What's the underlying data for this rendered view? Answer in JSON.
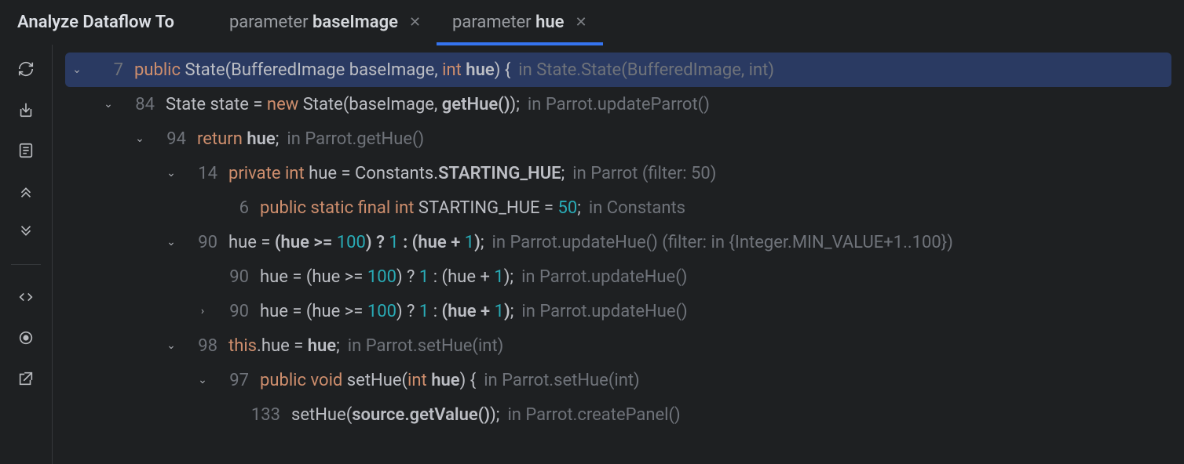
{
  "header": {
    "title": "Analyze Dataflow To",
    "tabs": [
      {
        "prefix": "parameter ",
        "name": "baseImage",
        "active": false
      },
      {
        "prefix": "parameter ",
        "name": "hue",
        "active": true
      }
    ]
  },
  "sidebar_icons": [
    "refresh-icon",
    "import-icon",
    "outline-icon",
    "collapse-up-icon",
    "collapse-down-icon",
    "divider",
    "code-icon",
    "target-icon",
    "open-external-icon"
  ],
  "rows": [
    {
      "indent": 0,
      "chev": "down",
      "line": 7,
      "sel": true,
      "tokens": [
        [
          "kw",
          "public"
        ],
        [
          "",
          " State(BufferedImage baseImage, "
        ],
        [
          "kw",
          "int"
        ],
        [
          "",
          " "
        ],
        [
          "str",
          "hue"
        ],
        [
          "",
          ") { "
        ]
      ],
      "loc": "in State.State(BufferedImage, int)"
    },
    {
      "indent": 1,
      "chev": "down",
      "line": 84,
      "tokens": [
        [
          "",
          "State state = "
        ],
        [
          "kw",
          "new"
        ],
        [
          "",
          " State(baseImage, "
        ],
        [
          "str",
          "getHue()"
        ],
        [
          "",
          ");"
        ]
      ],
      "loc": " in Parrot.updateParrot()"
    },
    {
      "indent": 2,
      "chev": "down",
      "line": 94,
      "tokens": [
        [
          "kw",
          "return"
        ],
        [
          "",
          " "
        ],
        [
          "str",
          "hue"
        ],
        [
          "",
          ";"
        ]
      ],
      "loc": " in Parrot.getHue()"
    },
    {
      "indent": 3,
      "chev": "down",
      "line": 14,
      "tokens": [
        [
          "kw",
          "private"
        ],
        [
          "",
          " "
        ],
        [
          "kw",
          "int"
        ],
        [
          "",
          " hue = Constants."
        ],
        [
          "str",
          "STARTING_HUE"
        ],
        [
          "",
          ";"
        ]
      ],
      "loc": " in Parrot (filter: 50)"
    },
    {
      "indent": 4,
      "chev": "",
      "line": 6,
      "tokens": [
        [
          "kw",
          "public"
        ],
        [
          "",
          " "
        ],
        [
          "kw",
          "static"
        ],
        [
          "",
          " "
        ],
        [
          "kw",
          "final"
        ],
        [
          "",
          " "
        ],
        [
          "kw",
          "int"
        ],
        [
          "",
          " STARTING_HUE = "
        ],
        [
          "num",
          "50"
        ],
        [
          "",
          ";"
        ]
      ],
      "loc": " in Constants"
    },
    {
      "indent": 3,
      "chev": "down",
      "line": 90,
      "tokens": [
        [
          "",
          "hue = "
        ],
        [
          "str",
          "(hue >= "
        ],
        [
          "num",
          "100"
        ],
        [
          "str",
          ") ? "
        ],
        [
          "num",
          "1"
        ],
        [
          "str",
          " : (hue + "
        ],
        [
          "num",
          "1"
        ],
        [
          "str",
          ")"
        ],
        [
          "",
          ";"
        ]
      ],
      "loc": " in Parrot.updateHue() (filter: in {Integer.MIN_VALUE+1..100})"
    },
    {
      "indent": 4,
      "chev": "",
      "line": 90,
      "tokens": [
        [
          "",
          "hue = (hue >= "
        ],
        [
          "num",
          "100"
        ],
        [
          "",
          ") ? "
        ],
        [
          "num",
          "1"
        ],
        [
          "",
          " : (hue + "
        ],
        [
          "num",
          "1"
        ],
        [
          "",
          ");"
        ]
      ],
      "loc": " in Parrot.updateHue()"
    },
    {
      "indent": 4,
      "chev": "right",
      "line": 90,
      "tokens": [
        [
          "",
          "hue = (hue >= "
        ],
        [
          "num",
          "100"
        ],
        [
          "",
          ") ? "
        ],
        [
          "num",
          "1"
        ],
        [
          "",
          " : "
        ],
        [
          "str",
          "(hue + "
        ],
        [
          "num",
          "1"
        ],
        [
          "str",
          ")"
        ],
        [
          "",
          ";"
        ]
      ],
      "loc": " in Parrot.updateHue()"
    },
    {
      "indent": 3,
      "chev": "down",
      "line": 98,
      "tokens": [
        [
          "kw",
          "this"
        ],
        [
          "",
          ".hue = "
        ],
        [
          "str",
          "hue"
        ],
        [
          "",
          ";"
        ]
      ],
      "loc": " in Parrot.setHue(int)"
    },
    {
      "indent": 4,
      "chev": "down",
      "line": 97,
      "tokens": [
        [
          "kw",
          "public"
        ],
        [
          "",
          " "
        ],
        [
          "kw",
          "void"
        ],
        [
          "",
          " setHue("
        ],
        [
          "kw",
          "int"
        ],
        [
          "",
          " "
        ],
        [
          "str",
          "hue"
        ],
        [
          "",
          ") {"
        ]
      ],
      "loc": " in Parrot.setHue(int)"
    },
    {
      "indent": 5,
      "chev": "",
      "line": 133,
      "tokens": [
        [
          "",
          "setHue("
        ],
        [
          "str",
          "source.getValue()"
        ],
        [
          "",
          ");"
        ]
      ],
      "loc": " in Parrot.createPanel()"
    }
  ]
}
